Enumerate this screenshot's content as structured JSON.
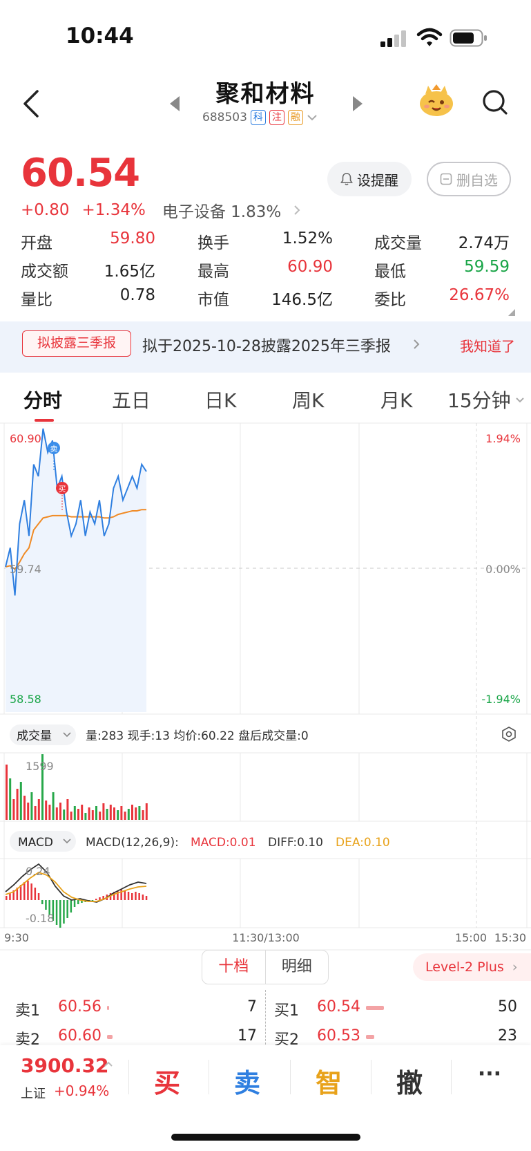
{
  "status_bar": {
    "time": "10:44"
  },
  "header": {
    "stock_name": "聚和材料",
    "code": "688503",
    "tags": [
      "科",
      "注",
      "融"
    ]
  },
  "quote": {
    "price": "60.54",
    "change": "+0.80",
    "change_pct": "+1.34%",
    "sector": "电子设备 1.83%",
    "alert_label": "设提醒",
    "remove_watch_label": "删自选",
    "stats": [
      {
        "label": "开盘",
        "value": "59.80",
        "color": "#e8343b"
      },
      {
        "label": "换手",
        "value": "1.52%",
        "color": "#222222"
      },
      {
        "label": "成交量",
        "value": "2.74万",
        "color": "#222222"
      },
      {
        "label": "成交额",
        "value": "1.65亿",
        "color": "#222222"
      },
      {
        "label": "最高",
        "value": "60.90",
        "color": "#e8343b"
      },
      {
        "label": "最低",
        "value": "59.59",
        "color": "#1aa548"
      },
      {
        "label": "量比",
        "value": "0.78",
        "color": "#222222"
      },
      {
        "label": "市值",
        "value": "146.5亿",
        "color": "#222222"
      },
      {
        "label": "委比",
        "value": "26.67%",
        "color": "#e8343b"
      }
    ]
  },
  "banner": {
    "tag": "拟披露三季报",
    "text": "拟于2025-10-28披露2025年三季报",
    "ack": "我知道了"
  },
  "tabs": [
    "分时",
    "五日",
    "日K",
    "周K",
    "月K",
    "15分钟"
  ],
  "chart": {
    "price_high": "60.90",
    "price_mid": "59.74",
    "price_low": "58.58",
    "pct_high": "1.94%",
    "pct_mid": "0.00%",
    "pct_low": "-1.94%",
    "sell_marker": "卖",
    "buy_marker": "买",
    "volume_selector": "成交量",
    "volume_info": "量:283  现手:13  均价:60.22  盘后成交量:0",
    "volume_max": "1599",
    "macd_selector": "MACD",
    "macd_params": "MACD(12,26,9):",
    "macd_value": "MACD:0.01",
    "diff_value": "DIFF:0.10",
    "dea_value": "DEA:0.10",
    "macd_top": "0.24",
    "macd_bottom": "-0.18",
    "time_labels": [
      "9:30",
      "11:30/13:00",
      "15:00",
      "15:30"
    ]
  },
  "chart_data": {
    "type": "line",
    "x": [
      "9:30",
      "11:30/13:00",
      "15:00"
    ],
    "ylim": [
      58.58,
      60.9
    ],
    "base_price": 59.74,
    "series": [
      {
        "values": [
          59.74,
          59.9,
          59.5,
          60.1,
          60.3,
          60.0,
          60.6,
          60.5,
          60.9,
          60.7,
          60.8,
          60.4,
          60.5,
          60.2,
          60.0,
          60.1,
          60.3,
          60.0,
          60.2,
          60.1,
          60.3,
          60.0,
          60.1,
          60.4,
          60.5,
          60.3,
          60.4,
          60.5,
          60.4,
          60.6,
          60.54
        ]
      },
      {
        "values": [
          59.74,
          59.75,
          59.72,
          59.78,
          59.85,
          59.9,
          60.05,
          60.1,
          60.15,
          60.16,
          60.17,
          60.17,
          60.17,
          60.17,
          60.16,
          60.16,
          60.16,
          60.16,
          60.16,
          60.16,
          60.16,
          60.15,
          60.15,
          60.16,
          60.18,
          60.19,
          60.2,
          60.21,
          60.21,
          60.22,
          60.22
        ]
      }
    ]
  },
  "order_book": {
    "tab_10": "十档",
    "tab_detail": "明细",
    "level2": "Level-2 Plus",
    "asks": [
      {
        "side": "卖1",
        "price": "60.56",
        "qty": "7"
      },
      {
        "side": "卖2",
        "price": "60.60",
        "qty": "17"
      }
    ],
    "bids": [
      {
        "side": "买1",
        "price": "60.54",
        "qty": "50"
      },
      {
        "side": "买2",
        "price": "60.53",
        "qty": "23"
      }
    ]
  },
  "bottom_bar": {
    "index_value": "3900.32",
    "index_name": "上证",
    "index_change": "+0.94%",
    "actions": [
      "买",
      "卖",
      "智",
      "撤",
      "···"
    ]
  }
}
